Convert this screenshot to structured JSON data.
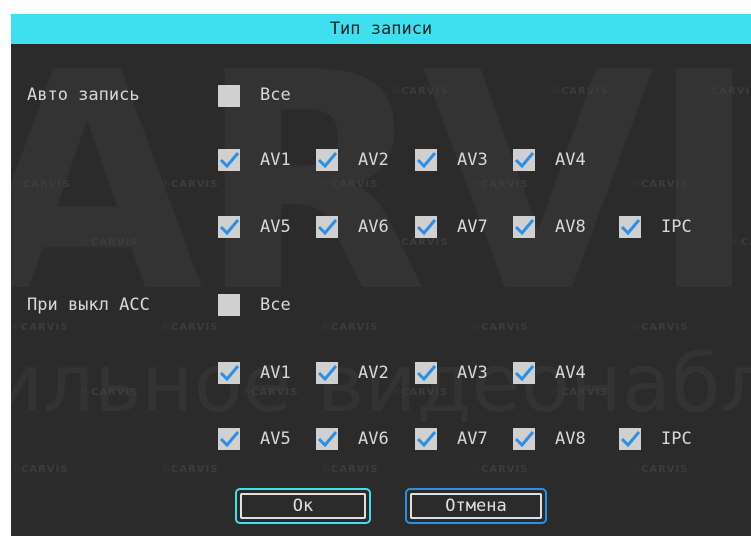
{
  "title": "Тип записи",
  "watermark": {
    "big": "ARVI",
    "line2": "ильное видеонаблюд",
    "brand": "CARVIS"
  },
  "auto": {
    "label": "Авто запись",
    "all_label": "Все",
    "all_checked": false,
    "channels": [
      {
        "label": "AV1",
        "checked": true
      },
      {
        "label": "AV2",
        "checked": true
      },
      {
        "label": "AV3",
        "checked": true
      },
      {
        "label": "AV4",
        "checked": true
      },
      {
        "label": "AV5",
        "checked": true
      },
      {
        "label": "AV6",
        "checked": true
      },
      {
        "label": "AV7",
        "checked": true
      },
      {
        "label": "AV8",
        "checked": true
      },
      {
        "label": "IPC",
        "checked": true
      }
    ]
  },
  "acc": {
    "label": "При выкл ACC",
    "all_label": "Все",
    "all_checked": false,
    "channels": [
      {
        "label": "AV1",
        "checked": true
      },
      {
        "label": "AV2",
        "checked": true
      },
      {
        "label": "AV3",
        "checked": true
      },
      {
        "label": "AV4",
        "checked": true
      },
      {
        "label": "AV5",
        "checked": true
      },
      {
        "label": "AV6",
        "checked": true
      },
      {
        "label": "AV7",
        "checked": true
      },
      {
        "label": "AV8",
        "checked": true
      },
      {
        "label": "IPC",
        "checked": true
      }
    ]
  },
  "buttons": {
    "ok": "Ок",
    "cancel": "Отмена"
  },
  "colors": {
    "title_bar": "#3ee0f0",
    "background": "#2b2b2b",
    "check_box": "#d0d0d0",
    "check_mark": "#2b8fe6",
    "ok_border": "#3ee0f0",
    "cancel_border": "#2b8fe6"
  },
  "icons": {
    "checked": "checkmark-icon",
    "unchecked": "empty-box-icon"
  }
}
